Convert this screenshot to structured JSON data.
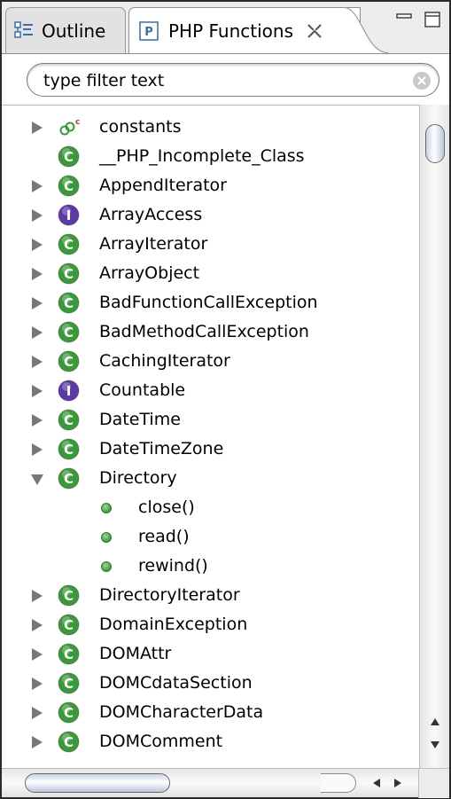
{
  "tabs": [
    {
      "label": "Outline",
      "icon": "outline-icon",
      "active": false
    },
    {
      "label": "PHP Functions",
      "icon": "php-file-icon",
      "active": true
    }
  ],
  "filter": {
    "placeholder": "type filter text",
    "value": ""
  },
  "tree": {
    "constants": {
      "label": "constants",
      "icon": "constants-icon",
      "expandable": true
    },
    "items": [
      {
        "label": "__PHP_Incomplete_Class",
        "kind": "class",
        "expandable": false
      },
      {
        "label": "AppendIterator",
        "kind": "class",
        "expandable": true
      },
      {
        "label": "ArrayAccess",
        "kind": "interface",
        "expandable": true
      },
      {
        "label": "ArrayIterator",
        "kind": "class",
        "expandable": true
      },
      {
        "label": "ArrayObject",
        "kind": "class",
        "expandable": true
      },
      {
        "label": "BadFunctionCallException",
        "kind": "class",
        "expandable": true
      },
      {
        "label": "BadMethodCallException",
        "kind": "class",
        "expandable": true
      },
      {
        "label": "CachingIterator",
        "kind": "class",
        "expandable": true
      },
      {
        "label": "Countable",
        "kind": "interface",
        "expandable": true
      },
      {
        "label": "DateTime",
        "kind": "class",
        "expandable": true
      },
      {
        "label": "DateTimeZone",
        "kind": "class",
        "expandable": true
      },
      {
        "label": "Directory",
        "kind": "class",
        "expandable": true,
        "expanded": true
      },
      {
        "label": "DirectoryIterator",
        "kind": "class",
        "expandable": true
      },
      {
        "label": "DomainException",
        "kind": "class",
        "expandable": true
      },
      {
        "label": "DOMAttr",
        "kind": "class",
        "expandable": true
      },
      {
        "label": "DOMCdataSection",
        "kind": "class",
        "expandable": true
      },
      {
        "label": "DOMCharacterData",
        "kind": "class",
        "expandable": true
      },
      {
        "label": "DOMComment",
        "kind": "class",
        "expandable": true
      }
    ],
    "directory_methods": [
      "close()",
      "read()",
      "rewind()"
    ]
  },
  "colors": {
    "class_icon": "#3a9a3a",
    "interface_icon": "#5b3aa8",
    "method_dot": "#4aa84a",
    "scroll_thumb": "#c8d3e2"
  }
}
